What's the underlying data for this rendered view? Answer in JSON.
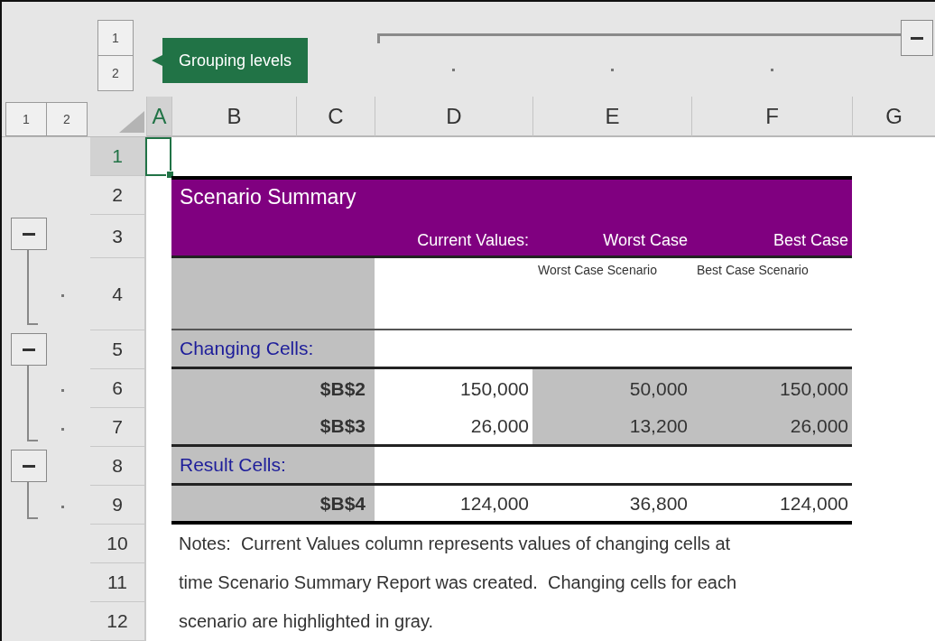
{
  "column_levels": [
    "1",
    "2"
  ],
  "row_levels": [
    "1",
    "2"
  ],
  "tooltip": "Grouping levels",
  "columns": [
    {
      "label": "A",
      "selected": true,
      "detail": false,
      "collapse_button": false
    },
    {
      "label": "B",
      "selected": false,
      "detail": false,
      "collapse_button": false
    },
    {
      "label": "C",
      "selected": false,
      "detail": false,
      "collapse_button": false
    },
    {
      "label": "D",
      "selected": false,
      "detail": true,
      "collapse_button": false
    },
    {
      "label": "E",
      "selected": false,
      "detail": true,
      "collapse_button": false
    },
    {
      "label": "F",
      "selected": false,
      "detail": true,
      "collapse_button": false
    },
    {
      "label": "G",
      "selected": false,
      "detail": false,
      "collapse_button": true
    }
  ],
  "rows": [
    {
      "number": "1",
      "selected": true,
      "kind": "blank",
      "detail": false,
      "collapse_button": false
    },
    {
      "number": "2",
      "selected": false,
      "kind": "title",
      "detail": false,
      "collapse_button": false,
      "text": "Scenario Summary"
    },
    {
      "number": "3",
      "selected": false,
      "kind": "header",
      "detail": false,
      "collapse_button": true,
      "cells": [
        {
          "text": "Current Values:"
        },
        {
          "text": "Worst Case"
        },
        {
          "text": "Best Case"
        }
      ]
    },
    {
      "number": "4",
      "selected": false,
      "kind": "names",
      "detail": true,
      "collapse_button": false,
      "cells": [
        {},
        {
          "text": "Worst Case Scenario"
        },
        {
          "text": "Best Case Scenario"
        }
      ]
    },
    {
      "number": "5",
      "selected": false,
      "kind": "section",
      "detail": false,
      "collapse_button": true,
      "text": "Changing Cells:"
    },
    {
      "number": "6",
      "selected": false,
      "kind": "value",
      "detail": true,
      "collapse_button": false,
      "text": "$B$2",
      "cells": [
        {
          "text": "150,000",
          "highlighted": false
        },
        {
          "text": "50,000",
          "highlighted": true
        },
        {
          "text": "150,000",
          "highlighted": true
        }
      ]
    },
    {
      "number": "7",
      "selected": false,
      "kind": "value",
      "detail": true,
      "collapse_button": false,
      "text": "$B$3",
      "cells": [
        {
          "text": "26,000",
          "highlighted": false
        },
        {
          "text": "13,200",
          "highlighted": true
        },
        {
          "text": "26,000",
          "highlighted": true
        }
      ]
    },
    {
      "number": "8",
      "selected": false,
      "kind": "section",
      "detail": false,
      "collapse_button": true,
      "text": "Result Cells:"
    },
    {
      "number": "9",
      "selected": false,
      "kind": "result",
      "detail": true,
      "collapse_button": false,
      "text": "$B$4",
      "cells": [
        {
          "text": "124,000",
          "highlighted": false
        },
        {
          "text": "36,800",
          "highlighted": false
        },
        {
          "text": "124,000",
          "highlighted": false
        }
      ]
    },
    {
      "number": "10",
      "selected": false,
      "kind": "note",
      "detail": false,
      "collapse_button": false,
      "text": "Notes:  Current Values column represents values of changing cells at"
    },
    {
      "number": "11",
      "selected": false,
      "kind": "note",
      "detail": false,
      "collapse_button": false,
      "text": "time Scenario Summary Report was created.  Changing cells for each"
    },
    {
      "number": "12",
      "selected": false,
      "kind": "note",
      "detail": false,
      "collapse_button": false,
      "text": "scenario are highlighted in gray."
    }
  ]
}
